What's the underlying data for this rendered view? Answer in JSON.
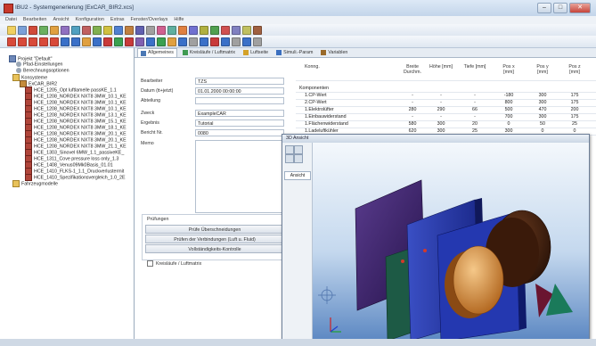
{
  "window": {
    "title": "IBU2 - Systemgenerierung [ExCAR_BIR2.xcs]"
  },
  "menu": [
    "Datei",
    "Bearbeiten",
    "Ansicht",
    "Konfiguration",
    "Extras",
    "Fenster/Overlays",
    "Hilfe"
  ],
  "tree": {
    "items": [
      {
        "label": "Projekt \"Default\"",
        "icon": "project-icon"
      },
      {
        "label": "Pfad-Einstellungen",
        "icon": "settings-icon"
      },
      {
        "label": "Berechnungsoptionen",
        "icon": "settings-icon"
      },
      {
        "label": "Konsysteme",
        "icon": "folder-icon"
      },
      {
        "label": "ExCAR_BIR2",
        "icon": "car-icon"
      },
      {
        "label": "HCE_1205_Opt luftlamelle passKE_1.1",
        "icon": "component-icon"
      },
      {
        "label": "HCE_1208_NORDEX NXT8 3MW_10.1_KE",
        "icon": "component-icon"
      },
      {
        "label": "HCE_1208_NORDEX NXT8 3MW_10.1_KE",
        "icon": "component-icon"
      },
      {
        "label": "HCE_1208_NORDEX NXT8 3MW_10.1_KE",
        "icon": "component-icon"
      },
      {
        "label": "HCE_1208_NORDEX NXT8 3MW_13.1_KE",
        "icon": "component-icon"
      },
      {
        "label": "HCE_1208_NORDEX NXT8 3MW_15.1_KE",
        "icon": "component-icon"
      },
      {
        "label": "HCE_1208_NORDEX NXT8 3MW_18.1_KE",
        "icon": "component-icon"
      },
      {
        "label": "HCE_1208_NORDEX NXT8 3MW_20.1_KE",
        "icon": "component-icon"
      },
      {
        "label": "HCE_1208_NORDEX NXT8 3MW_20.1_KE",
        "icon": "component-icon"
      },
      {
        "label": "HCE_1208_NORDEX NXT8 3MW_21.1_KE",
        "icon": "component-icon"
      },
      {
        "label": "HCE_1303_Sinovel 6MW_1.1_passiveKE_",
        "icon": "component-icon"
      },
      {
        "label": "HCE_1311_Cove pressure loss only_1.3",
        "icon": "component-icon"
      },
      {
        "label": "HCE_1408_Venus09Mk0Basis_01.01",
        "icon": "component-icon"
      },
      {
        "label": "HCE_1410_FLKS-1_1.1_Druckverlustermit",
        "icon": "component-icon"
      },
      {
        "label": "HCE_1410_Spezifikationsvergleich_1.0_2E",
        "icon": "component-icon"
      },
      {
        "label": "Fahrzeugmodelle",
        "icon": "folder-icon"
      }
    ]
  },
  "tabs": [
    {
      "label": "Allgemeines",
      "color": "#4a78b5"
    },
    {
      "label": "Kreisläufe / Luftmatrix",
      "color": "#3e9a52"
    },
    {
      "label": "Luftseite",
      "color": "#d4a229"
    },
    {
      "label": "Simuli.-Param",
      "color": "#3a6fbf"
    },
    {
      "label": "Variablen",
      "color": "#9a6a2a"
    }
  ],
  "form": {
    "fields": [
      {
        "label": "Bearbeiter",
        "value": "TZS"
      },
      {
        "label": "Datum (tt+jetzt)",
        "value": "01.01.2000 00:00:00"
      },
      {
        "label": "Abteilung",
        "value": ""
      },
      {
        "label": "Zweck",
        "value": "ExampleCAR"
      },
      {
        "label": "Ergebnis",
        "value": "Tutorial"
      },
      {
        "label": "Bericht Nr.",
        "value": "0080"
      }
    ],
    "memo_label": "Memo",
    "group_caption": "Prüfungen",
    "buttons": [
      "Prüfe Überschneidungen",
      "Prüfen der Verbindungen (Luft u. Fluid)",
      "Vollständigkeits-Kontrolle"
    ],
    "checkbox_label": "Kreisläufe / Luftmatrix"
  },
  "grid": {
    "headers": [
      "Konng.",
      "Breite Durchm.",
      "Höhe [mm]",
      "Tiefe [mm]",
      "Pos x [mm]",
      "Pos y [mm]",
      "Pos z [mm]"
    ],
    "rows": [
      {
        "name": "Komponenten",
        "cells": [
          "",
          "",
          "",
          "",
          "",
          ""
        ]
      },
      {
        "name": "1.CP-Wert",
        "cells": [
          "-",
          "-",
          "-",
          "-180",
          "300",
          "175"
        ]
      },
      {
        "name": "2.CP-Wert",
        "cells": [
          "-",
          "-",
          "-",
          "800",
          "300",
          "175"
        ]
      },
      {
        "name": "1.Elektrolüfter",
        "cells": [
          "280",
          "290",
          "66",
          "500",
          "470",
          "200"
        ]
      },
      {
        "name": "1.Einbauwiderstand",
        "cells": [
          "-",
          "-",
          "-",
          "700",
          "300",
          "175"
        ]
      },
      {
        "name": "1.Flächenwiderstand",
        "cells": [
          "580",
          "300",
          "20",
          "0",
          "50",
          "25"
        ]
      },
      {
        "name": "1.Ladeluftkühler",
        "cells": [
          "620",
          "300",
          "25",
          "300",
          "0",
          "0"
        ]
      }
    ]
  },
  "view3d": {
    "title": "3D Ansicht",
    "view_label": "Ansicht"
  }
}
